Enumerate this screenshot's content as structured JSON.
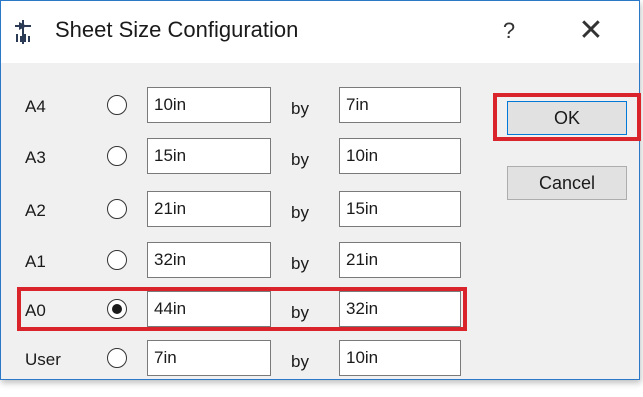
{
  "dialog": {
    "title": "Sheet Size Configuration",
    "help_label": "?",
    "close_label": "✕"
  },
  "sizes": [
    {
      "label": "A4",
      "selected": false,
      "width": "10in",
      "by": "by",
      "height": "7in"
    },
    {
      "label": "A3",
      "selected": false,
      "width": "15in",
      "by": "by",
      "height": "10in"
    },
    {
      "label": "A2",
      "selected": false,
      "width": "21in",
      "by": "by",
      "height": "15in"
    },
    {
      "label": "A1",
      "selected": false,
      "width": "32in",
      "by": "by",
      "height": "21in"
    },
    {
      "label": "A0",
      "selected": true,
      "width": "44in",
      "by": "by",
      "height": "32in"
    },
    {
      "label": "User",
      "selected": false,
      "width": "7in",
      "by": "by",
      "height": "10in"
    }
  ],
  "buttons": {
    "ok_label": "OK",
    "cancel_label": "Cancel"
  },
  "colors": {
    "highlight": "#d9242b",
    "title_bar": "#ffffff",
    "dialog_bg": "#f0f0f0",
    "window_border": "#2b78c8"
  }
}
